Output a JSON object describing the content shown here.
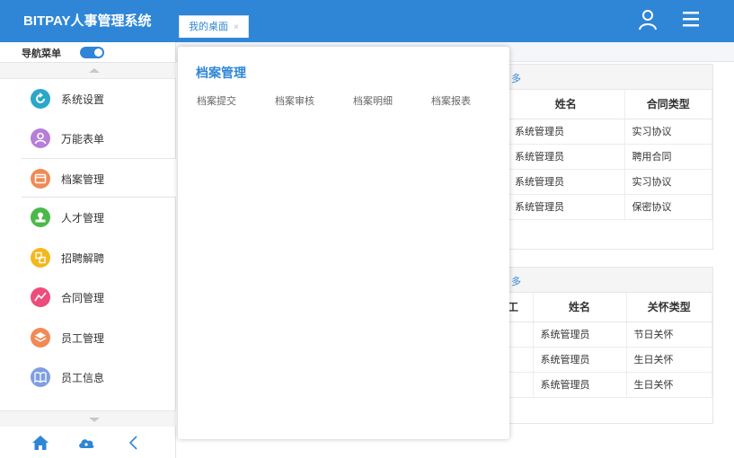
{
  "brand": {
    "title": "BITPAY人事管理系统"
  },
  "tabs": [
    {
      "label": "我的桌面",
      "close": "×"
    }
  ],
  "header_icons": {
    "user": "user-icon",
    "menu": "hamburger-menu-icon"
  },
  "sidebar": {
    "toggle_label": "导航菜单",
    "toggle_on": true,
    "items": [
      {
        "label": "系统设置",
        "icon": "refresh-icon",
        "color": "#2aa7c9"
      },
      {
        "label": "万能表单",
        "icon": "user-icon",
        "color": "#b57fd8"
      },
      {
        "label": "档案管理",
        "icon": "folder-icon",
        "color": "#f08a56",
        "active": true
      },
      {
        "label": "人才管理",
        "icon": "stamp-icon",
        "color": "#4cb849"
      },
      {
        "label": "招聘解聘",
        "icon": "doc-icon",
        "color": "#f3b81b"
      },
      {
        "label": "合同管理",
        "icon": "trend-icon",
        "color": "#ec4d7b"
      },
      {
        "label": "员工管理",
        "icon": "layers-icon",
        "color": "#f08a56"
      },
      {
        "label": "员工信息",
        "icon": "book-icon",
        "color": "#7d9fe0"
      }
    ],
    "bottom": [
      "home-icon",
      "cloud-icon",
      "collapse-left-icon"
    ]
  },
  "main": {
    "panel1": {
      "more": "多",
      "columns": [
        "姓名",
        "合同类型"
      ],
      "rows": [
        [
          "系统管理员",
          "实习协议"
        ],
        [
          "系统管理员",
          "聘用合同"
        ],
        [
          "系统管理员",
          "实习协议"
        ],
        [
          "系统管理员",
          "保密协议"
        ]
      ]
    },
    "panel2": {
      "more": "多",
      "lead_col": "工",
      "columns": [
        "姓名",
        "关怀类型"
      ],
      "rows": [
        [
          "系统管理员",
          "节日关怀"
        ],
        [
          "系统管理员",
          "生日关怀"
        ],
        [
          "系统管理员",
          "生日关怀"
        ]
      ]
    }
  },
  "popup": {
    "title": "档案管理",
    "links": [
      "档案提交",
      "档案审核",
      "档案明细",
      "档案报表"
    ]
  }
}
